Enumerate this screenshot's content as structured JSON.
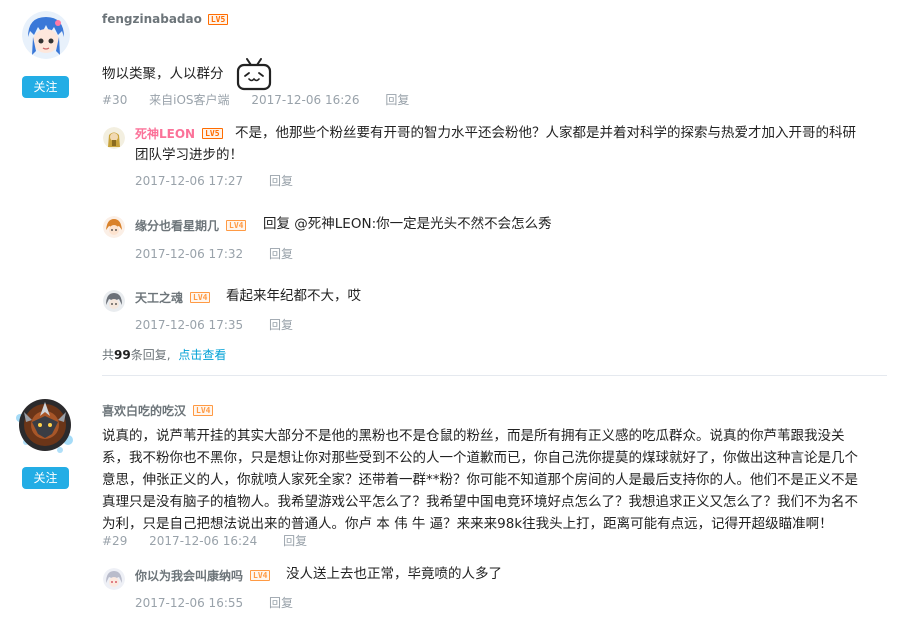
{
  "comments": [
    {
      "username": "fengzinabadao",
      "level": "LV5",
      "follow_label": "关注",
      "text": "物以类聚，人以群分",
      "emoji_name": "tv-face-emoji",
      "floor": "#30",
      "source": "来自iOS客户端",
      "time": "2017-12-06 16:26",
      "reply_label": "回复",
      "replies": [
        {
          "username": "死神LEON",
          "level": "LV5",
          "text_line1": "不是，他那些个粉丝要有开哥的智力水平还会粉他？人家都是并着对科学的探索与热爱才加入开哥的科研",
          "text_line2": "团队学习进步的！",
          "time": "2017-12-06 17:27",
          "reply_label": "回复"
        },
        {
          "username": "缘分也看星期几",
          "level": "LV4",
          "text": "回复 @死神LEON:你一定是光头不然不会怎么秀",
          "time": "2017-12-06 17:32",
          "reply_label": "回复"
        },
        {
          "username": "天工之魂",
          "level": "LV4",
          "text": "看起来年纪都不大，哎",
          "time": "2017-12-06 17:35",
          "reply_label": "回复"
        }
      ],
      "more_prefix": "共",
      "more_count": "99",
      "more_suffix": "条回复,",
      "more_link": "点击查看"
    },
    {
      "username": "喜欢白吃的吃汉",
      "level": "LV4",
      "follow_label": "关注",
      "text_lines": [
        "说真的，说芦苇开挂的其实大部分不是他的黑粉也不是仓鼠的粉丝，而是所有拥有正义感的吃瓜群众。说真的你芦苇跟我没关",
        "系，我不粉你也不黑你，只是想让你对那些受到不公的人一个道歉而已，你自己洗你提莫的煤球就好了，你做出这种言论是几个",
        "意思，伸张正义的人，你就喷人家死全家？还带着一群**粉？你可能不知道那个房间的人是最后支持你的人。他们不是正义不是",
        "真理只是没有脑子的植物人。我希望游戏公平怎么了？我希望中国电竞环境好点怎么了？我想追求正义又怎么了？我们不为名不",
        "为利，只是自己把想法说出来的普通人。你卢 本 伟 牛 逼？来来来98k往我头上打，距离可能有点远，记得开超级瞄准啊！"
      ],
      "floor": "#29",
      "time": "2017-12-06 16:24",
      "reply_label": "回复",
      "replies": [
        {
          "username": "你以为我会叫康纳吗",
          "level": "LV4",
          "text": "没人送上去也正常，毕竟喷的人多了",
          "time": "2017-12-06 16:55",
          "reply_label": "回复"
        }
      ]
    }
  ],
  "colors": {
    "follow_bg": "#23ade5",
    "vip_name": "#fb7299",
    "link": "#00a1d6",
    "meta": "#99a2aa",
    "lv5": "#ff6c00",
    "lv4": "#ff9a44"
  }
}
